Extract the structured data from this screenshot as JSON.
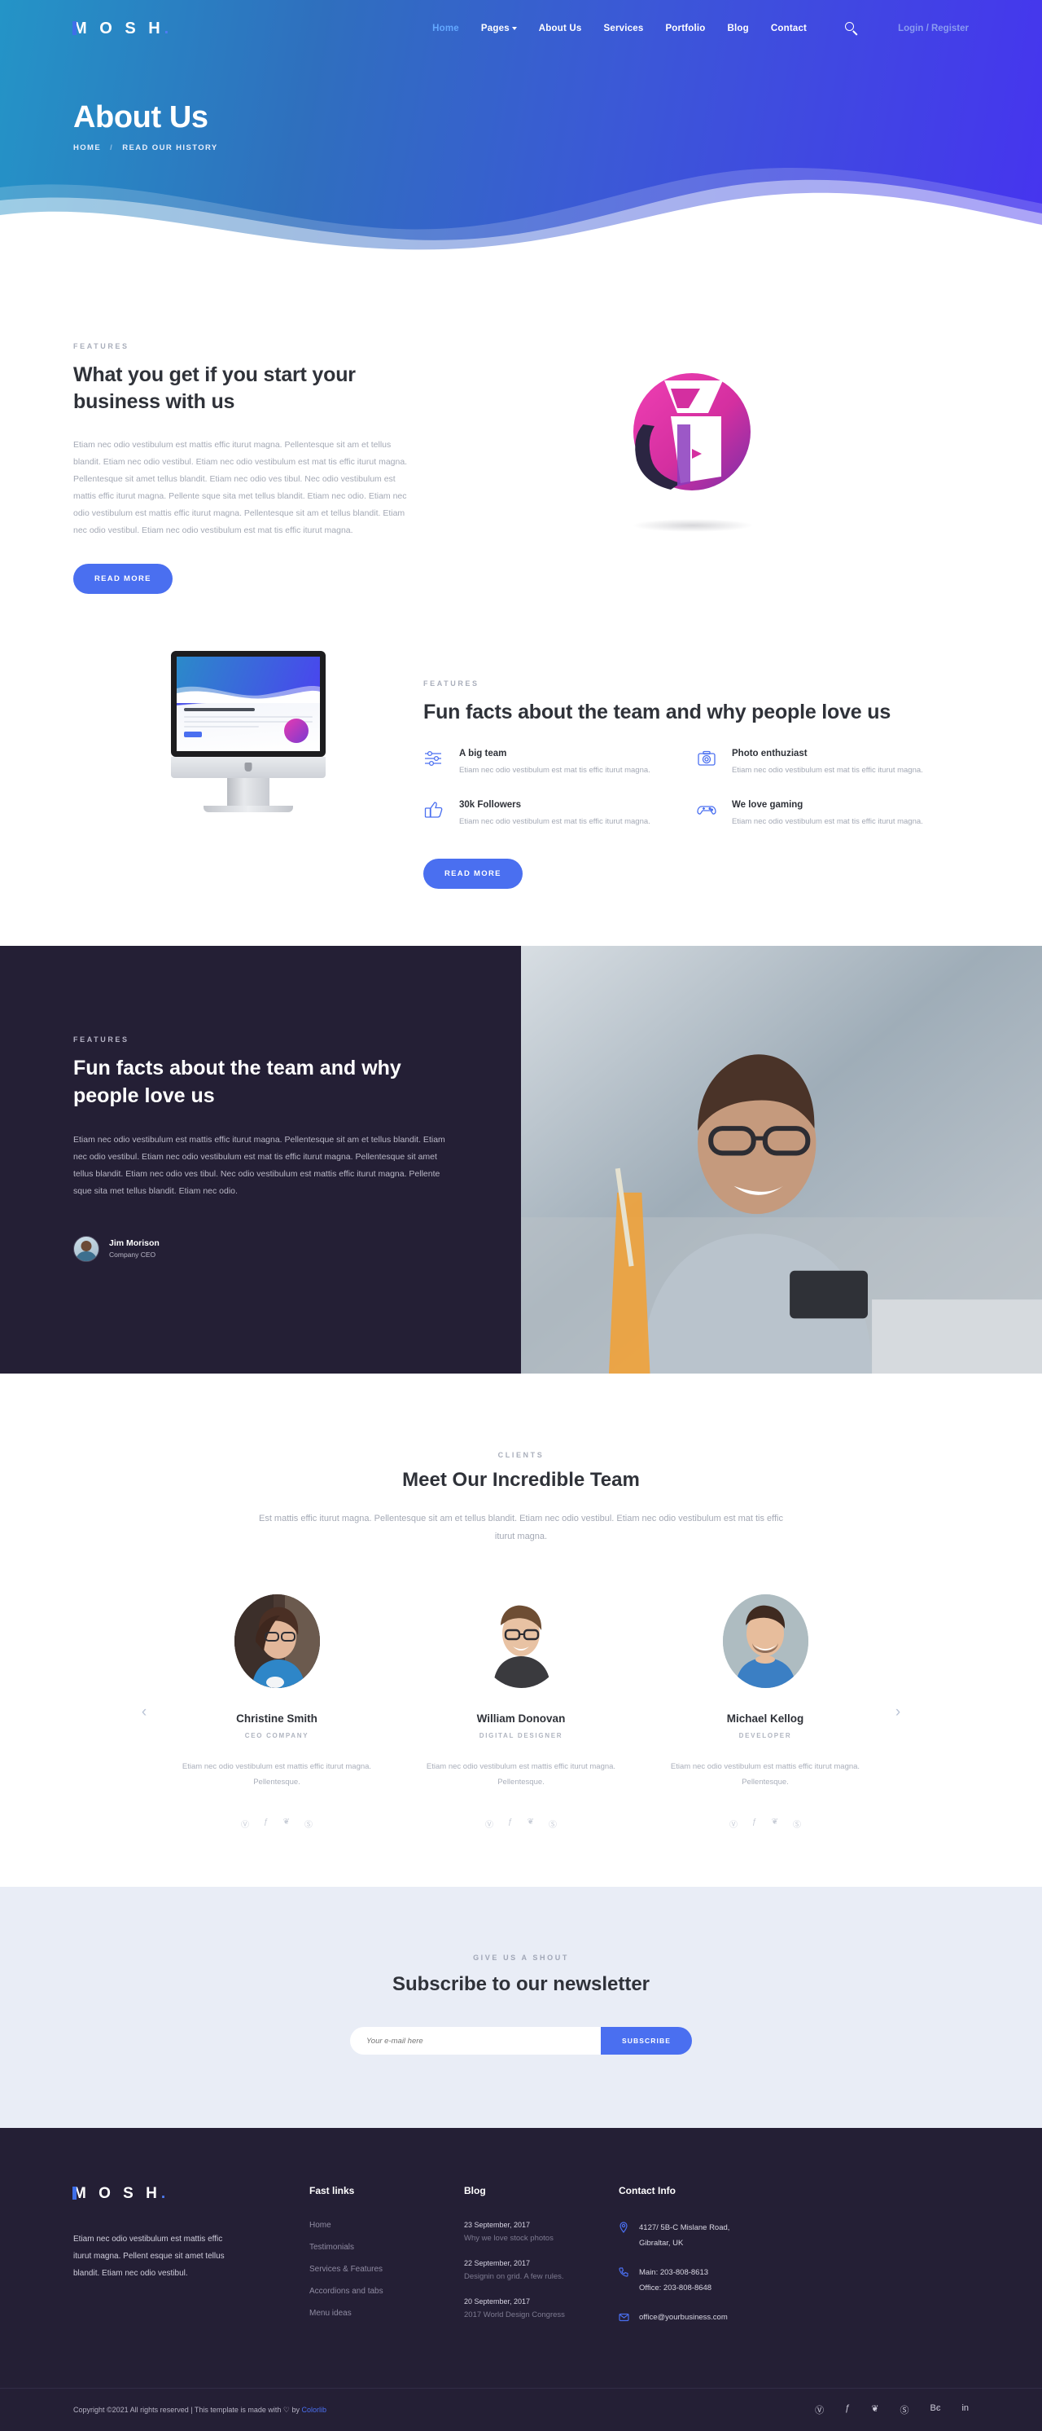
{
  "brand": {
    "name": "M O S H",
    "dot": ".",
    "accent": "#4a6ff0"
  },
  "nav": {
    "items": [
      {
        "label": "Home",
        "active": true
      },
      {
        "label": "Pages",
        "dropdown": true
      },
      {
        "label": "About Us"
      },
      {
        "label": "Services"
      },
      {
        "label": "Portfolio"
      },
      {
        "label": "Blog"
      },
      {
        "label": "Contact"
      }
    ],
    "search_icon": "search-icon",
    "login": "Login / Register"
  },
  "hero": {
    "title": "About Us",
    "crumb_home": "HOME",
    "crumb_sep": "/",
    "crumb_current": "READ OUR HISTORY"
  },
  "features_section": {
    "eyebrow": "FEATURES",
    "title": "What you get if you start your business with us",
    "body": "Etiam nec odio vestibulum est mattis effic iturut magna. Pellentesque sit am et tellus blandit. Etiam nec odio vestibul. Etiam nec odio vestibulum est mat tis effic iturut magna. Pellentesque sit amet tellus blandit. Etiam nec odio ves tibul. Nec odio vestibulum est mattis effic iturut magna. Pellente sque sita met tellus blandit. Etiam nec odio. Etiam nec odio vestibulum est mattis effic iturut magna. Pellentesque sit am et tellus blandit. Etiam nec odio vestibul. Etiam nec odio vestibulum est mat tis effic iturut magna.",
    "button": "READ MORE",
    "image_name": "abstract-sphere-graphic"
  },
  "funfacts_section": {
    "eyebrow": "FEATURES",
    "title": "Fun facts about the team and why people love us",
    "button": "READ MORE",
    "image_name": "imac-mockup",
    "items": [
      {
        "icon": "sliders-icon",
        "title": "A big team",
        "text": "Etiam nec odio vestibulum est mat tis effic iturut magna."
      },
      {
        "icon": "camera-icon",
        "title": "Photo enthuziast",
        "text": "Etiam nec odio vestibulum est mat tis effic iturut magna."
      },
      {
        "icon": "thumbs-up-icon",
        "title": "30k Followers",
        "text": "Etiam nec odio vestibulum est mat tis effic iturut magna."
      },
      {
        "icon": "gamepad-icon",
        "title": "We love gaming",
        "text": "Etiam nec odio vestibulum est mat tis effic iturut magna."
      }
    ]
  },
  "dark_section": {
    "eyebrow": "FEATURES",
    "title": "Fun facts about the team and why people love us",
    "body": "Etiam nec odio vestibulum est mattis effic iturut magna. Pellentesque sit am et tellus blandit. Etiam nec odio vestibul. Etiam nec odio vestibulum est mat tis effic iturut magna. Pellentesque sit amet tellus blandit. Etiam nec odio ves tibul. Nec odio vestibulum est mattis effic iturut magna. Pellente sque sita met tellus blandit. Etiam nec odio.",
    "author_name": "Jim Morison",
    "author_role": "Company CEO",
    "photo_name": "man-with-phone-photo",
    "bg_color": "#241f35"
  },
  "team": {
    "eyebrow": "CLIENTS",
    "title": "Meet Our Incredible Team",
    "lead": "Est mattis effic iturut magna. Pellentesque sit am et tellus blandit. Etiam nec odio vestibul. Etiam nec odio vestibulum est mat tis effic iturut magna.",
    "prev_icon": "chevron-left-icon",
    "next_icon": "chevron-right-icon",
    "members": [
      {
        "name": "Christine Smith",
        "role": "CEO COMPANY",
        "desc": "Etiam nec odio vestibulum est mattis effic iturut magna. Pellentesque.",
        "socials": [
          "pinterest-icon",
          "facebook-icon",
          "twitter-icon",
          "instagram-icon"
        ]
      },
      {
        "name": "William Donovan",
        "role": "DIGITAL DESIGNER",
        "desc": "Etiam nec odio vestibulum est mattis effic iturut magna. Pellentesque.",
        "socials": [
          "pinterest-icon",
          "facebook-icon",
          "twitter-icon",
          "instagram-icon"
        ]
      },
      {
        "name": "Michael Kellog",
        "role": "DEVELOPER",
        "desc": "Etiam nec odio vestibulum est mattis effic iturut magna. Pellentesque.",
        "socials": [
          "pinterest-icon",
          "facebook-icon",
          "twitter-icon",
          "instagram-icon"
        ]
      }
    ]
  },
  "newsletter": {
    "eyebrow": "GIVE US A SHOUT",
    "title": "Subscribe to our newsletter",
    "placeholder": "Your e-mail here",
    "value": "",
    "button": "SUBSCRIBE",
    "bg_color": "#e9edf6"
  },
  "footer": {
    "about": "Etiam nec odio vestibulum est mattis effic iturut magna. Pellent esque sit amet tellus blandit. Etiam nec odio vestibul.",
    "fastlinks_title": "Fast links",
    "fastlinks": [
      "Home",
      "Testimonials",
      "Services & Features",
      "Accordions and tabs",
      "Menu ideas"
    ],
    "blog_title": "Blog",
    "blog": [
      {
        "date": "23 September, 2017",
        "title": "Why we love stock photos"
      },
      {
        "date": "22 September, 2017",
        "title": "Designin on grid. A few rules."
      },
      {
        "date": "20 September, 2017",
        "title": "2017 World Design Congress"
      }
    ],
    "contact_title": "Contact Info",
    "contact": [
      {
        "icon": "location-pin-icon",
        "line1": "4127/ 5B-C Mislane Road,",
        "line2": "Gibraltar, UK"
      },
      {
        "icon": "phone-icon",
        "line1": "Main: 203-808-8613",
        "line2": "Office: 203-808-8648"
      },
      {
        "icon": "envelope-icon",
        "line1": "office@yourbusiness.com",
        "line2": ""
      }
    ],
    "copyright_pre": "Copyright ©2021 All rights reserved | This template is made with ",
    "copyright_heart": "♡",
    "copyright_by": " by ",
    "copyright_link": "Colorlib",
    "socials": [
      "pinterest-icon",
      "facebook-icon",
      "twitter-icon",
      "dribbble-icon",
      "behance-icon",
      "linkedin-icon"
    ]
  }
}
